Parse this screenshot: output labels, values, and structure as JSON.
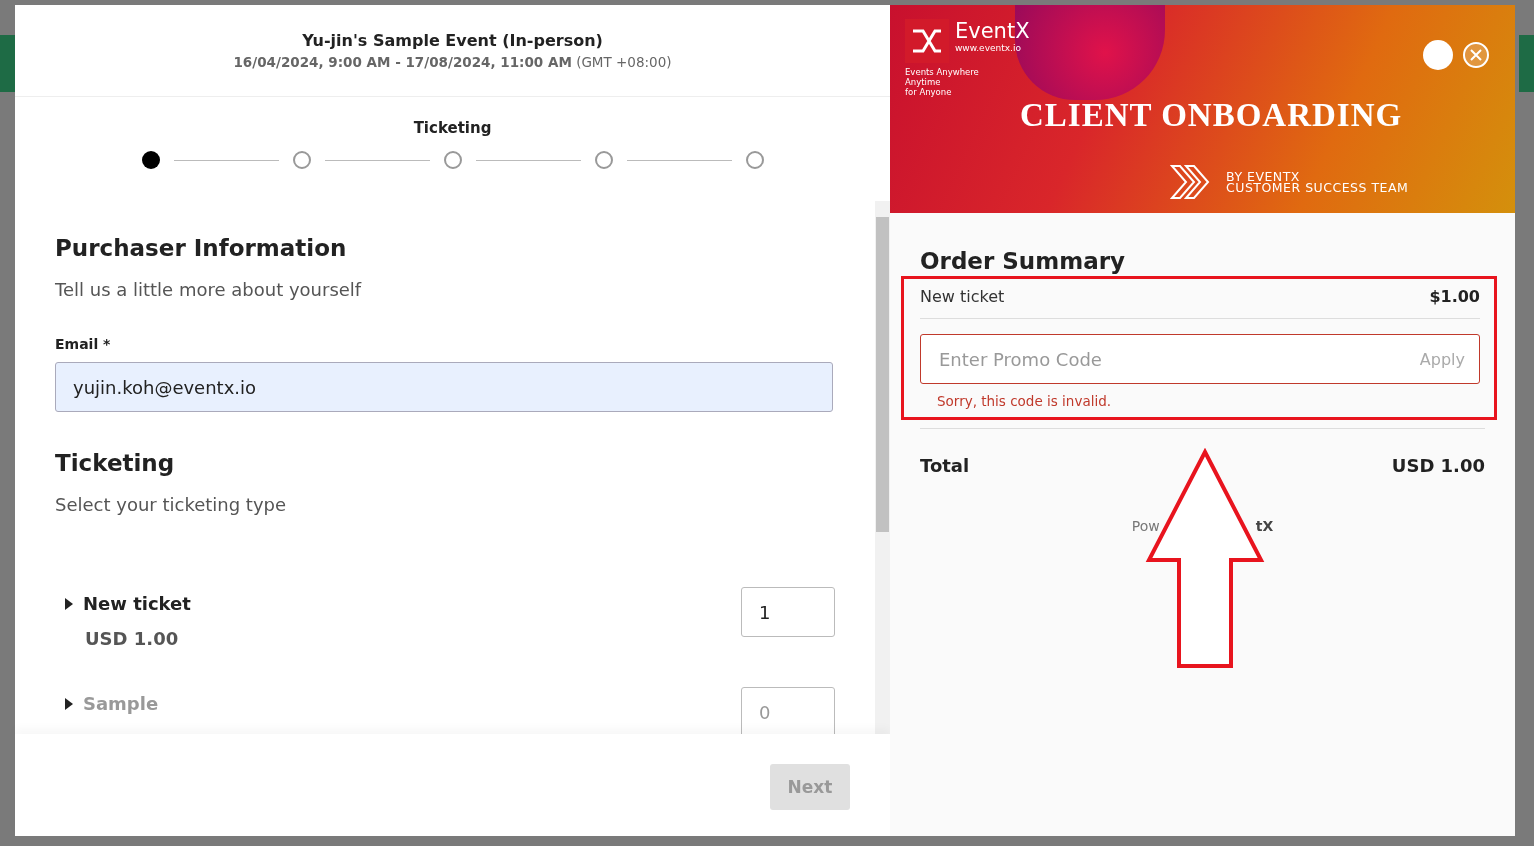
{
  "event": {
    "title": "Yu-jin's Sample Event (In-person)",
    "dates": "16/04/2024, 9:00 AM - 17/08/2024, 11:00 AM",
    "timezone": "(GMT +08:00)"
  },
  "stepper": {
    "label": "Ticketing",
    "steps": [
      {
        "selected": true
      },
      {
        "selected": false
      },
      {
        "selected": false
      },
      {
        "selected": false
      },
      {
        "selected": false
      }
    ]
  },
  "purchaser": {
    "heading": "Purchaser Information",
    "subheading": "Tell us a little more about yourself",
    "email_label": "Email *",
    "email_value": "yujin.koh@eventx.io"
  },
  "ticketing": {
    "heading": "Ticketing",
    "subheading": "Select your ticketing type",
    "tickets": [
      {
        "name": "New ticket",
        "price": "USD 1.00",
        "quantity": "1",
        "disabled": false
      },
      {
        "name": "Sample",
        "quantity": "0",
        "disabled": true
      }
    ]
  },
  "next_button": {
    "label": "Next",
    "disabled": true
  },
  "banner": {
    "brand": "EventX",
    "url": "www.eventx.io",
    "tagline": [
      "Events Anywhere",
      "Anytime",
      "for Anyone"
    ],
    "title": "CLIENT ONBOARDING",
    "byline": [
      "BY EVENTX",
      "CUSTOMER SUCCESS TEAM"
    ]
  },
  "summary": {
    "heading": "Order Summary",
    "item_name": "New ticket",
    "item_price": "$1.00",
    "promo_placeholder": "Enter Promo Code",
    "apply_label": "Apply",
    "error": "Sorry, this code is invalid.",
    "total_label": "Total",
    "total_value": "USD 1.00",
    "footer_left": "Pow",
    "footer_right": "tX"
  }
}
